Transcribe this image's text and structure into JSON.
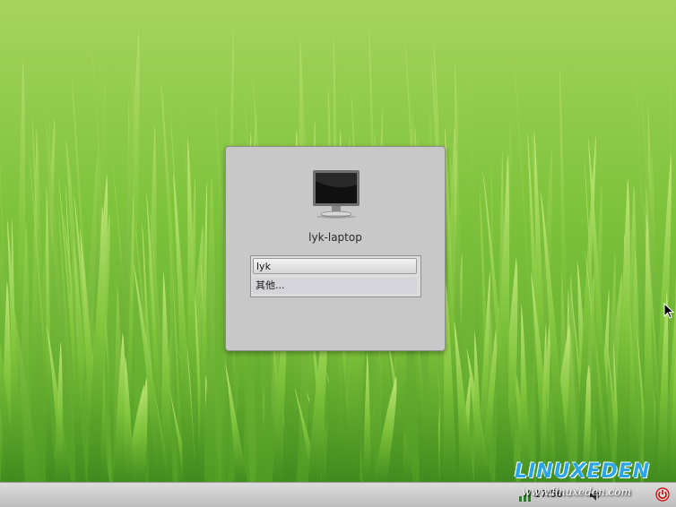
{
  "desktop": {
    "wallpaper": "green grass",
    "accent_color": "#7cc23a"
  },
  "login": {
    "hostname": "lyk-laptop",
    "computer_icon": "monitor-icon",
    "users": [
      {
        "label": "lyk",
        "selected": true
      },
      {
        "label": "其他..."
      }
    ]
  },
  "panel": {
    "time": "17:56",
    "icons": [
      "network-icon",
      "volume-icon",
      "power-icon"
    ]
  },
  "watermark": {
    "logo": "LINUXEDEN",
    "url": "www.linuxeden.com"
  }
}
